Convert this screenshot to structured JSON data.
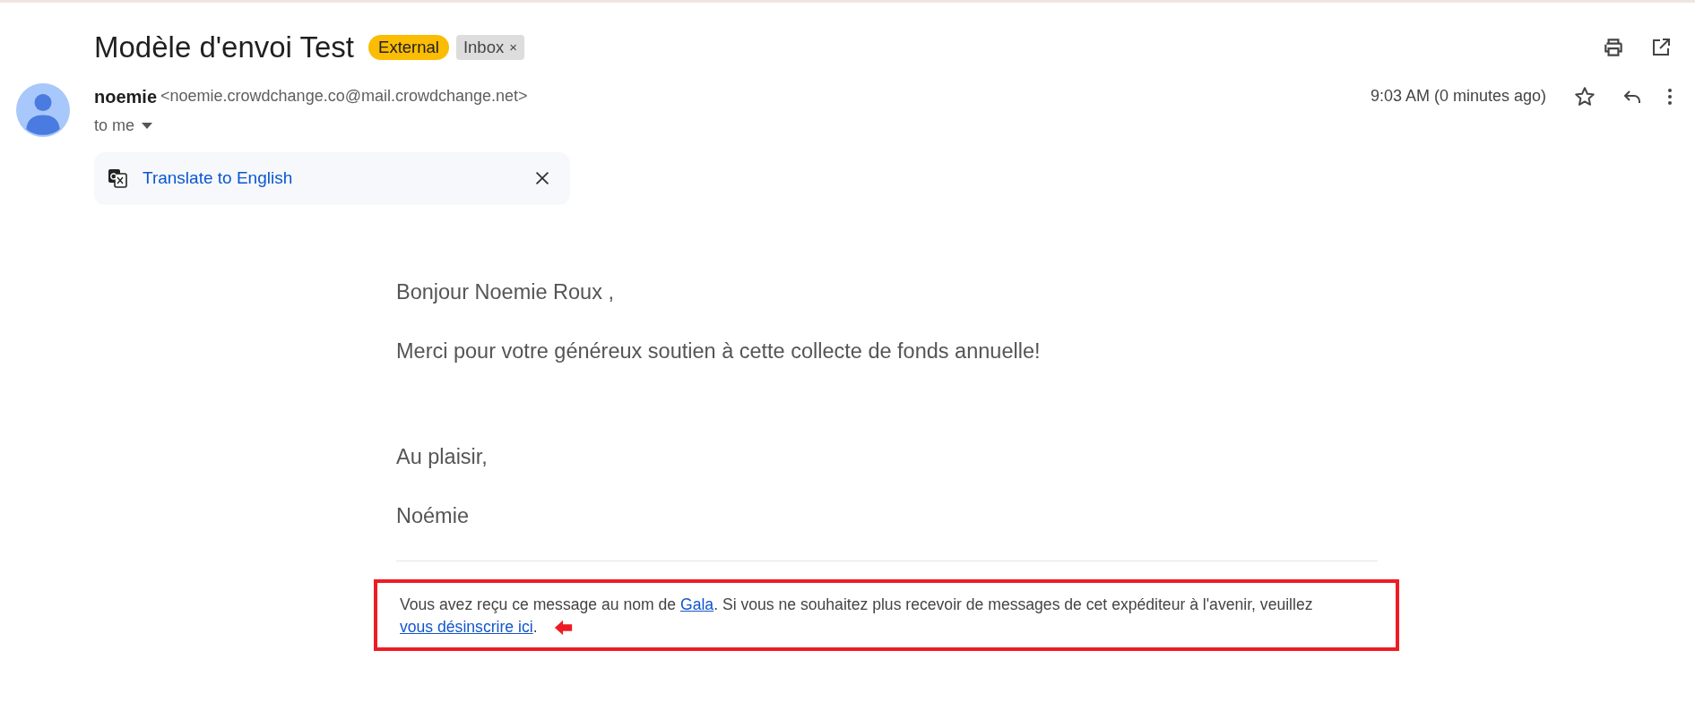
{
  "subject": "Modèle d'envoi Test",
  "labels": [
    {
      "text": "External",
      "kind": "warning"
    },
    {
      "text": "Inbox",
      "kind": "plain",
      "remove": "×"
    }
  ],
  "sender": {
    "name": "noemie",
    "email": "<noemie.crowdchange.co@mail.crowdchange.net>",
    "recipient": "to me"
  },
  "time": "9:03 AM (0 minutes ago)",
  "starred": false,
  "translate": {
    "label": "Translate to English"
  },
  "body": [
    "Bonjour Noemie Roux ,",
    "Merci pour votre généreux soutien à cette collecte de fonds annuelle!",
    "Au plaisir,",
    "Noémie"
  ],
  "footer": [
    {
      "kind": "text",
      "text": "Vous avez reçu ce message au nom de "
    },
    {
      "kind": "link",
      "text": "Gala"
    },
    {
      "kind": "text",
      "text": ". Si vous ne souhaitez plus recevoir de messages de cet expéditeur à l'avenir, veuillez "
    },
    {
      "kind": "link",
      "text": "vous désinscrire ici"
    },
    {
      "kind": "text",
      "text": "."
    }
  ],
  "annotation": {
    "color": "#ed1c24"
  }
}
